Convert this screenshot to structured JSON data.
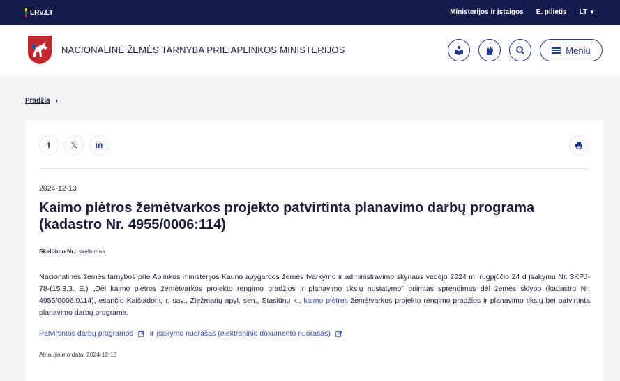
{
  "topbar": {
    "brand": "LRV.LT",
    "links": [
      "Ministerijos ir įstaigos",
      "E. pilietis"
    ],
    "language": "LT"
  },
  "header": {
    "site_title": "NACIONALINĖ ŽEMĖS TARNYBA PRIE APLINKOS MINISTERIJOS",
    "menu_label": "Meniu",
    "icons": [
      "easy-read-icon",
      "sign-language-icon",
      "search-icon",
      "menu-icon"
    ]
  },
  "breadcrumb": {
    "home": "Pradžia",
    "separator": "›"
  },
  "article": {
    "share_labels": [
      "f",
      "𝕏",
      "in"
    ],
    "date": "2024-12-13",
    "title": "Kaimo plėtros žemėtvarkos projekto patvirtinta planavimo darbų programa (kadastro Nr. 4955/0006:114)",
    "meta_label": "Skelbimo Nr.:",
    "meta_value": "skelbimas",
    "body_before_link": "Nacionalinės žemės tarnybos prie Aplinkos ministerijos Kauno apygardos žemės tvarkymo ir administravimo skyriaus vedėjo 2024 m. rugpjūčio 24 d įsakymu Nr. 3KPJ-78-(15.3.3. E.) „Dėl kaimo plėtros žemėtvarkos projekto rengimo pradžios ir planavimo tikslų nustatymo\" priimtas sprendimas dėl žemės sklypo (kadastro Nr. 4955/0006:0114), esančio Kaišiadorių r. sav., Žiežmarių apyl. sen., Stasiūnų k., ",
    "body_link": "kaimo plėtros",
    "body_after_link": " žemėtvarkos projekto rengimo pradžios ir planavimo tikslų bei patvirtinta planavimo darbų programa.",
    "link1": "Patvirtintos darbų programos",
    "connector": "ir",
    "link2": "įsakymo nuorašas (elektroninio dokumento nuorašas)",
    "updated": "Atnaujinimo data: 2024-12-13"
  },
  "colors": {
    "topbar": "#141b4d",
    "accent": "#1e3a8a",
    "link": "#2c4cb0"
  }
}
